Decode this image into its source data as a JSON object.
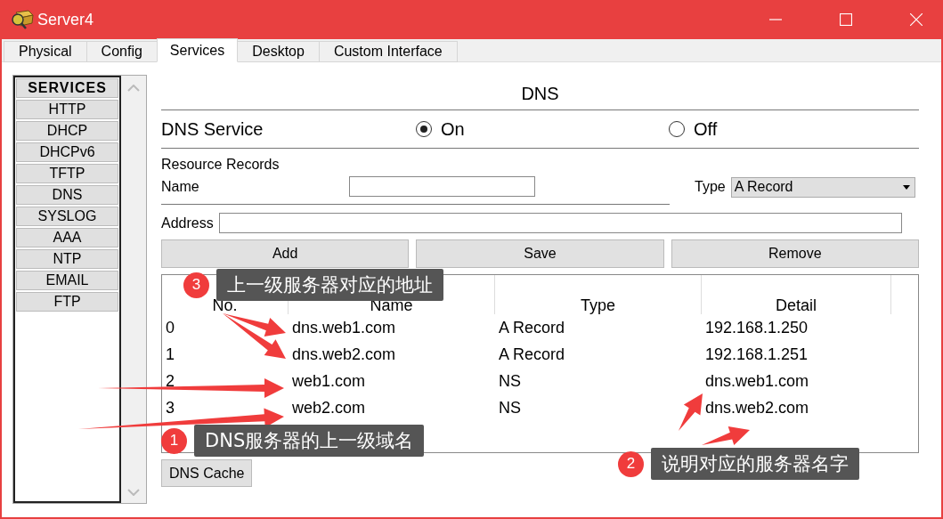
{
  "window": {
    "title": "Server4"
  },
  "tabs": [
    {
      "label": "Physical",
      "selected": false
    },
    {
      "label": "Config",
      "selected": false
    },
    {
      "label": "Services",
      "selected": true
    },
    {
      "label": "Desktop",
      "selected": false
    },
    {
      "label": "Custom Interface",
      "selected": false
    }
  ],
  "services": {
    "heading": "SERVICES",
    "items": [
      "HTTP",
      "DHCP",
      "DHCPv6",
      "TFTP",
      "DNS",
      "SYSLOG",
      "AAA",
      "NTP",
      "EMAIL",
      "FTP"
    ]
  },
  "panel": {
    "title": "DNS",
    "service_label": "DNS Service",
    "options": [
      {
        "label": "On",
        "selected": true
      },
      {
        "label": "Off",
        "selected": false
      }
    ],
    "section": "Resource Records",
    "name_label": "Name",
    "type_label": "Type",
    "type_value": "A Record",
    "address_label": "Address",
    "buttons": [
      "Add",
      "Save",
      "Remove"
    ],
    "table": {
      "columns": [
        "No.",
        "Name",
        "Type",
        "Detail"
      ],
      "rows": [
        [
          "0",
          "dns.web1.com",
          "A Record",
          "192.168.1.250"
        ],
        [
          "1",
          "dns.web2.com",
          "A Record",
          "192.168.1.251"
        ],
        [
          "2",
          "web1.com",
          "NS",
          "dns.web1.com"
        ],
        [
          "3",
          "web2.com",
          "NS",
          "dns.web2.com"
        ]
      ]
    },
    "cache_button": "DNS Cache"
  },
  "annotations": [
    {
      "number": "3",
      "text": "上一级服务器对应的地址"
    },
    {
      "number": "1",
      "text": "DNS服务器的上一级域名"
    },
    {
      "number": "2",
      "text": "说明对应的服务器名字"
    }
  ]
}
